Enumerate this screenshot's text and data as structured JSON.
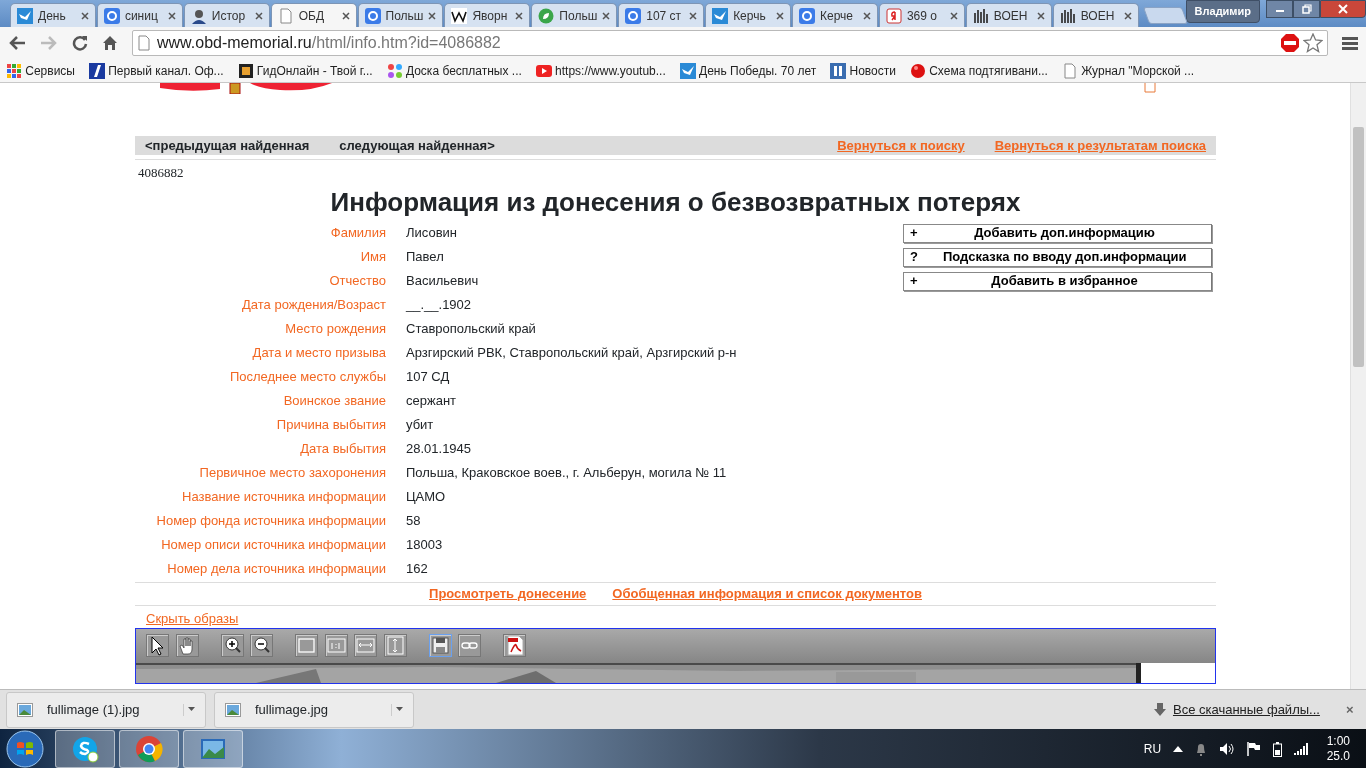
{
  "browser": {
    "tabs": [
      {
        "title": "День",
        "kind": "bird",
        "selected": false
      },
      {
        "title": "синиц",
        "kind": "google",
        "selected": false
      },
      {
        "title": "Истор",
        "kind": "person",
        "selected": false
      },
      {
        "title": "ОБД",
        "kind": "page",
        "selected": true
      },
      {
        "title": "Польш",
        "kind": "google",
        "selected": false
      },
      {
        "title": "Яворн",
        "kind": "wiki",
        "selected": false
      },
      {
        "title": "Польш",
        "kind": "leaf",
        "selected": false
      },
      {
        "title": "107 ст",
        "kind": "google",
        "selected": false
      },
      {
        "title": "Керчь",
        "kind": "bird",
        "selected": false
      },
      {
        "title": "Керче",
        "kind": "google",
        "selected": false
      },
      {
        "title": "369 о",
        "kind": "yandex",
        "selected": false
      },
      {
        "title": "ВОЕН",
        "kind": "building",
        "selected": false
      },
      {
        "title": "ВОЕН",
        "kind": "building",
        "selected": false
      }
    ],
    "profile": "Владимир",
    "address": {
      "host": "www.obd-memorial.ru",
      "path": "/html/info.htm?id=4086882"
    },
    "bookmarks": [
      {
        "label": "Сервисы",
        "kind": "grid"
      },
      {
        "label": "Первый канал. Оф...",
        "kind": "channel"
      },
      {
        "label": "ГидОнлайн - Твой г...",
        "kind": "frame"
      },
      {
        "label": "Доска бесплатных ...",
        "kind": "dots"
      },
      {
        "label": "https://www.youtub...",
        "kind": "play"
      },
      {
        "label": "День Победы. 70 лет",
        "kind": "bird"
      },
      {
        "label": "Новости",
        "kind": "pause"
      },
      {
        "label": "Схема подтягивани...",
        "kind": "ball"
      },
      {
        "label": "Журнал \"Морской ...",
        "kind": "page"
      }
    ]
  },
  "page": {
    "nav": {
      "prev": "<предыдущая найденная",
      "next": "следующая найденная>",
      "links": [
        "Вернуться к поиску",
        "Вернуться к результатам поиска"
      ]
    },
    "record_id": "4086882",
    "title": "Информация из донесения о безвозвратных потерях",
    "fields": [
      {
        "label": "Фамилия",
        "value": "Лисовин"
      },
      {
        "label": "Имя",
        "value": "Павел"
      },
      {
        "label": "Отчество",
        "value": "Васильевич"
      },
      {
        "label": "Дата рождения/Возраст",
        "value": "__.__.1902"
      },
      {
        "label": "Место рождения",
        "value": "Ставропольский край"
      },
      {
        "label": "Дата и место призыва",
        "value": "Арзгирский РВК, Ставропольский край, Арзгирский р-н"
      },
      {
        "label": "Последнее место службы",
        "value": "107 СД"
      },
      {
        "label": "Воинское звание",
        "value": "сержант"
      },
      {
        "label": "Причина выбытия",
        "value": "убит"
      },
      {
        "label": "Дата выбытия",
        "value": "28.01.1945"
      },
      {
        "label": "Первичное место захоронения",
        "value": "Польша, Краковское воев., г. Альберун, могила № 11"
      },
      {
        "label": "Название источника информации",
        "value": "ЦАМО"
      },
      {
        "label": "Номер фонда источника информации",
        "value": "58"
      },
      {
        "label": "Номер описи источника информации",
        "value": "18003"
      },
      {
        "label": "Номер дела источника информации",
        "value": "162"
      }
    ],
    "actions": [
      {
        "symbol": "+",
        "label": "Добавить доп.информацию"
      },
      {
        "symbol": "?",
        "label": "Подсказка по вводу доп.информации"
      },
      {
        "symbol": "+",
        "label": "Добавить в избранное"
      }
    ],
    "footer_links": [
      "Просмотреть донесение",
      "Обобщенная информация и список документов"
    ],
    "hide_images": "Скрыть образы",
    "viewer_tool_groups": [
      [
        {
          "kind": "pointer",
          "selected": false
        },
        {
          "kind": "hand",
          "selected": false
        }
      ],
      [
        {
          "kind": "zoom-in",
          "selected": false
        },
        {
          "kind": "zoom-out",
          "selected": false
        }
      ],
      [
        {
          "kind": "fit",
          "selected": false
        },
        {
          "kind": "actual",
          "selected": false
        },
        {
          "kind": "width",
          "selected": false
        },
        {
          "kind": "height",
          "selected": false
        }
      ],
      [
        {
          "kind": "save",
          "selected": true
        },
        {
          "kind": "link",
          "selected": false
        }
      ],
      [
        {
          "kind": "pdf",
          "selected": false
        }
      ]
    ]
  },
  "downloads": {
    "files": [
      "fullimage (1).jpg",
      "fullimage.jpg"
    ],
    "all": "Все скачанные файлы...",
    "close": "×"
  },
  "taskbar": {
    "apps": [
      {
        "kind": "skype"
      },
      {
        "kind": "chrome"
      },
      {
        "kind": "photos"
      }
    ],
    "lang": "RU",
    "time": "1:00",
    "date": "25.0"
  }
}
